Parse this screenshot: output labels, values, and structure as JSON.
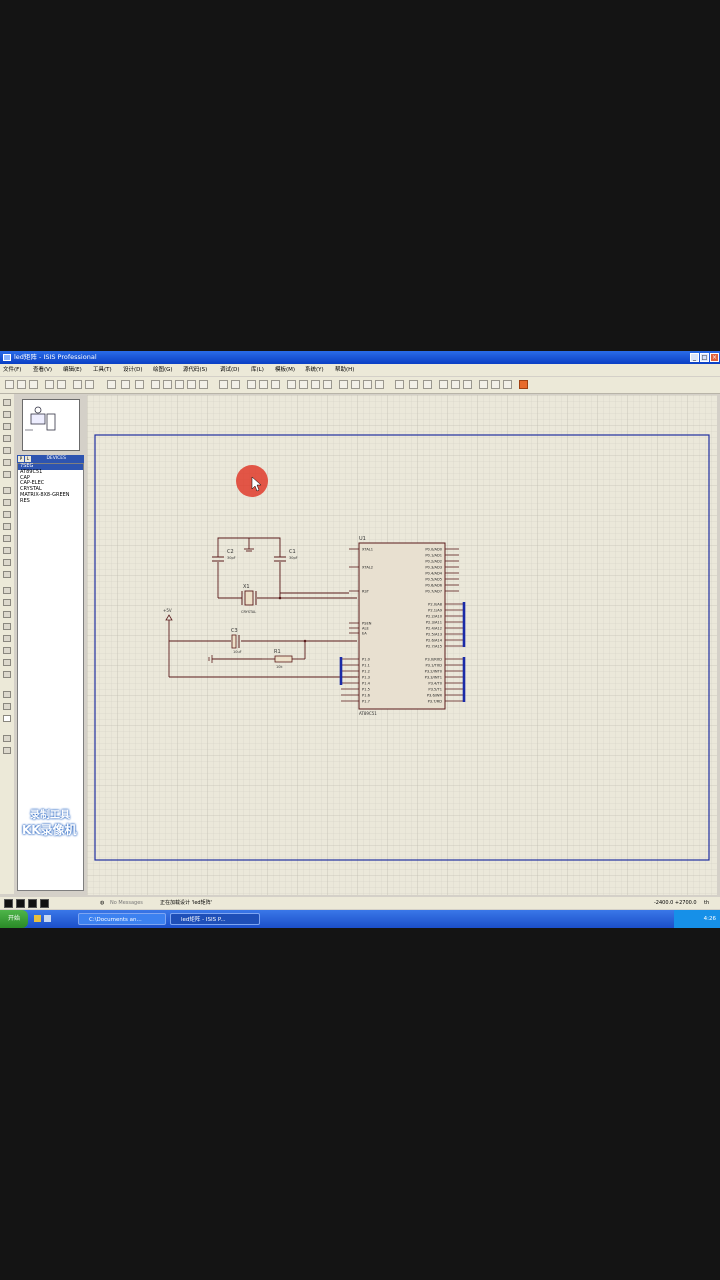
{
  "window": {
    "title": "led矩阵 - ISIS Professional"
  },
  "menu": [
    "文件(F)",
    "查看(V)",
    "编辑(E)",
    "工具(T)",
    "设计(D)",
    "绘图(G)",
    "源代码(S)",
    "调试(D)",
    "库(L)",
    "模板(M)",
    "系统(Y)",
    "帮助(H)"
  ],
  "device_panel": {
    "tabs": [
      "P",
      "L"
    ],
    "header": "DEVICES",
    "items": [
      "7SEG",
      "AT89C51",
      "CAP",
      "CAP-ELEC",
      "CRYSTAL",
      "MATRIX-8X8-GREEN",
      "RES"
    ],
    "selected_index": 0
  },
  "schematic": {
    "components": {
      "c2": {
        "ref": "C2",
        "value": "30pF"
      },
      "c1": {
        "ref": "C1",
        "value": "30pF"
      },
      "x1": {
        "ref": "X1",
        "value": "CRYSTAL"
      },
      "c3": {
        "ref": "C3",
        "value": "10uF"
      },
      "r1": {
        "ref": "R1",
        "value": "10k"
      },
      "u1": {
        "ref": "U1",
        "part": "AT89C51"
      },
      "power": "+5V"
    },
    "chip_left_pins": [
      "XTAL1",
      "XTAL2",
      "RST",
      "PSEN",
      "ALE",
      "EA"
    ],
    "chip_left_p1": [
      "P1.0",
      "P1.1",
      "P1.2",
      "P1.3",
      "P1.4",
      "P1.5",
      "P1.6",
      "P1.7"
    ],
    "chip_right_p0": [
      "P0.0/AD0",
      "P0.1/AD1",
      "P0.2/AD2",
      "P0.3/AD3",
      "P0.4/AD4",
      "P0.5/AD5",
      "P0.6/AD6",
      "P0.7/AD7"
    ],
    "chip_right_p2": [
      "P2.0/A8",
      "P2.1/A9",
      "P2.2/A10",
      "P2.3/A11",
      "P2.4/A12",
      "P2.5/A13",
      "P2.6/A14",
      "P2.7/A15"
    ],
    "chip_right_p3": [
      "P3.0/RXD",
      "P3.1/TXD",
      "P3.2/INT0",
      "P3.3/INT1",
      "P3.4/T0",
      "P3.5/T1",
      "P3.6/WR",
      "P3.7/RD"
    ]
  },
  "status": {
    "messages": "No Messages",
    "text": "正在加载设计 'led矩阵'",
    "coords": "-2400.0  +2700.0",
    "coords_unit": "th"
  },
  "taskbar": {
    "start": "开始",
    "tasks": [
      "C:\\Documents an...",
      "led矩阵 - ISIS P..."
    ],
    "clock": "4:26"
  },
  "watermark": {
    "line1": "录制工具",
    "line2": "KK录像机"
  },
  "colors": {
    "title_bar": "#0a3fc4",
    "sheet_border": "#2030a0",
    "wire": "#5a1a1a",
    "bus": "#1a2aa8",
    "cursor_highlight": "#e03020"
  }
}
